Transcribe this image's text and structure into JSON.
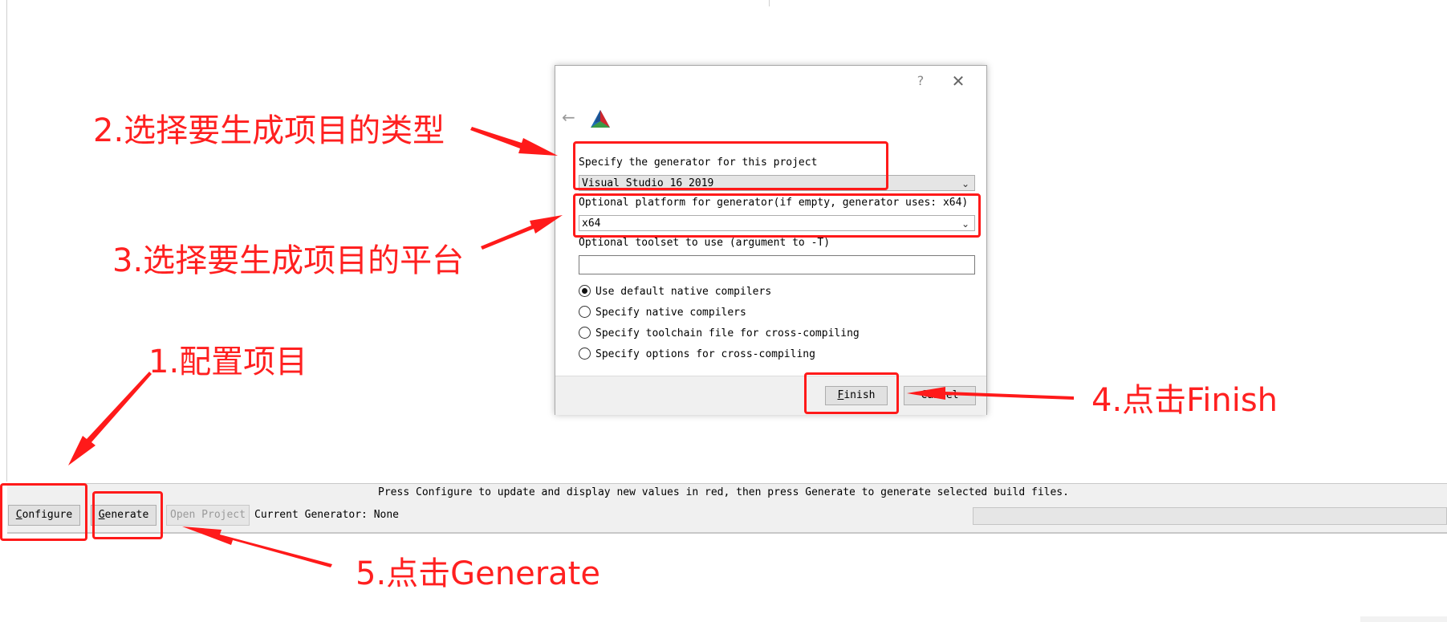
{
  "dialog": {
    "help_glyph": "?",
    "close_glyph": "✕",
    "back_glyph": "←",
    "generator_label": "Specify the generator for this project",
    "generator_value": "Visual Studio 16 2019",
    "platform_label": "Optional platform for generator(if empty, generator uses: x64)",
    "platform_value": "x64",
    "toolset_label": "Optional toolset to use (argument to -T)",
    "toolset_value": "",
    "radio_options": [
      {
        "label": "Use default native compilers",
        "selected": true
      },
      {
        "label": "Specify native compilers",
        "selected": false
      },
      {
        "label": "Specify toolchain file for cross-compiling",
        "selected": false
      },
      {
        "label": "Specify options for cross-compiling",
        "selected": false
      }
    ],
    "finish_first": "F",
    "finish_rest": "inish",
    "cancel_label": "Cancel"
  },
  "toolbar": {
    "hint": "Press Configure to update and display new values in red, then press Generate to generate selected build files.",
    "configure_first": "C",
    "configure_rest": "onfigure",
    "generate_first": "G",
    "generate_rest": "enerate",
    "open_project_label": "Open Project",
    "current_generator": "Current Generator: None"
  },
  "annotations": {
    "step1": "1.配置项目",
    "step2": "2.选择要生成项目的类型",
    "step3": "3.选择要生成项目的平台",
    "step4": "4.点击Finish",
    "step5": "5.点击Generate",
    "color": "#ff2020"
  }
}
